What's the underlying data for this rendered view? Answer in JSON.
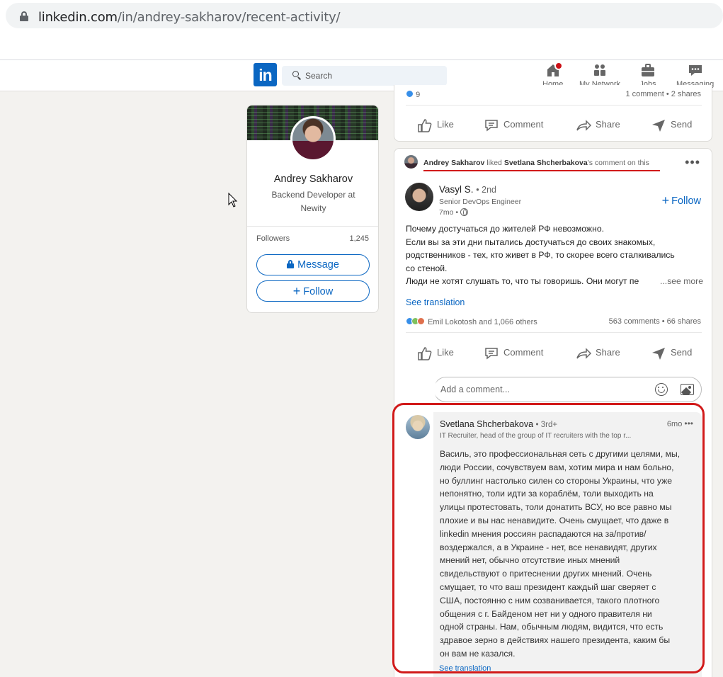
{
  "browser": {
    "url_domain": "linkedin.com",
    "url_path": "/in/andrey-sakharov/recent-activity/"
  },
  "nav": {
    "logo": "in",
    "search_placeholder": "Search",
    "items": [
      {
        "label": "Home"
      },
      {
        "label": "My Network"
      },
      {
        "label": "Jobs"
      },
      {
        "label": "Messaging"
      }
    ],
    "home_badge_color": "#cc1016"
  },
  "profile": {
    "name": "Andrey Sakharov",
    "headline": "Backend Developer at Newity",
    "followers_label": "Followers",
    "followers_count": "1,245",
    "message_label": "Message",
    "follow_label": "Follow"
  },
  "top_post": {
    "reactions_count": "9",
    "counts": "1 comment • 2 shares",
    "actions": [
      "Like",
      "Comment",
      "Share",
      "Send"
    ]
  },
  "activity": {
    "actor": "Andrey Sakharov",
    "verb": "liked",
    "target": "Svetlana Shcherbakova",
    "suffix": "'s comment on this"
  },
  "post": {
    "author_name": "Vasyl S.",
    "author_degree": "• 2nd",
    "author_headline": "Senior DevOps Engineer",
    "time": "7mo •",
    "follow_label": "Follow",
    "lines": [
      "Почему достучаться до жителей РФ невозможно.",
      "Если вы за эти дни пытались достучаться до своих знакомых,",
      "родственников - тех, кто живет в РФ, то скорее всего сталкивались",
      "со стеной.",
      "Люди не хотят слушать то, что ты говоришь. Они могут пе"
    ],
    "see_more": "...see more",
    "see_translation": "See translation",
    "reactions_text": "Emil Lokotosh and 1,066 others",
    "counts": "563 comments • 66 shares",
    "actions": [
      "Like",
      "Comment",
      "Share",
      "Send"
    ],
    "comment_placeholder": "Add a comment..."
  },
  "comment": {
    "author_name": "Svetlana Shcherbakova",
    "author_degree": "• 3rd+",
    "time": "6mo",
    "headline": "IT Recruiter, head of the group of IT recruiters with the top r...",
    "lines": [
      "Василь, это профессиональная сеть с другими целями, мы,",
      "люди России, сочувствуем вам, хотим мира и нам больно,",
      "но буллинг настолько силен со стороны Украины, что уже",
      "непонятно, толи идти за кораблём, толи выходить на",
      "улицы протестовать, толи донатить ВСУ, но все равно мы",
      "плохие и вы нас ненавидите. Очень смущает, что даже в",
      "linkedin мнения россиян распадаются на за/против/",
      "воздержался, а в Украине - нет, все ненавидят, других",
      "мнений нет, обычно отсутствие иных мнений",
      "свидельствуют о притеснении других мнений. Очень",
      "смущает, то что ваш президент каждый шаг сверяет с",
      "США, постоянно с ним созванивается, такого плотного",
      "общения с г. Байденом нет ни у одного правителя ни",
      "одной страны. Нам, обычным людям, видится, что есть",
      "здравое зерно в действиях нашего президента, каким бы",
      "он вам не казался."
    ],
    "see_translation": "See translation"
  },
  "colors": {
    "brand": "#0a66c2",
    "highlight": "#d11a1a"
  }
}
